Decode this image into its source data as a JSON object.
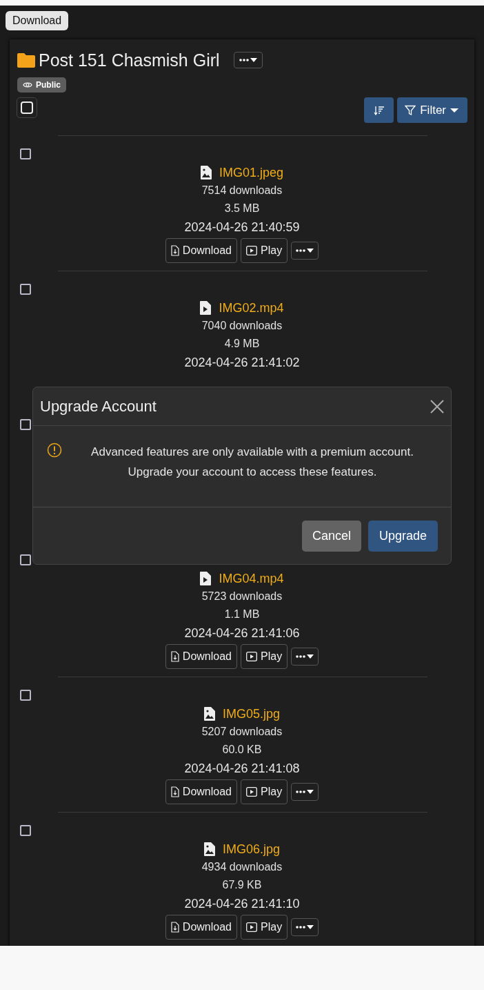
{
  "tooltip": "Download",
  "folder": {
    "title": "Post 151 Chasmish Girl",
    "visibility": "Public",
    "all_checked": false
  },
  "toolbar": {
    "filter": "Filter"
  },
  "rows": [
    {
      "checked": false,
      "kind": "image",
      "name": "IMG01.jpeg",
      "downloads": "7514 downloads",
      "size": "3.5 MB",
      "date": "2024-04-26 21:40:59",
      "actions": [
        "Download",
        "Play"
      ]
    },
    {
      "checked": false,
      "kind": "video",
      "name": "IMG02.mp4",
      "downloads": "7040 downloads",
      "size": "4.9 MB",
      "date": "2024-04-26 21:41:02"
    },
    {
      "checked": false
    },
    {
      "checked": false,
      "kind": "video",
      "name": "IMG04.mp4",
      "downloads": "5723 downloads",
      "size": "1.1 MB",
      "date": "2024-04-26 21:41:06",
      "actions": [
        "Download",
        "Play"
      ]
    },
    {
      "checked": false,
      "kind": "image",
      "name": "IMG05.jpg",
      "downloads": "5207 downloads",
      "size": "60.0 KB",
      "date": "2024-04-26 21:41:08",
      "actions": [
        "Download",
        "Play"
      ]
    },
    {
      "checked": false,
      "kind": "image",
      "name": "IMG06.jpg",
      "downloads": "4934 downloads",
      "size": "67.9 KB",
      "date": "2024-04-26 21:41:10",
      "actions": [
        "Download",
        "Play"
      ]
    }
  ],
  "modal": {
    "title": "Upgrade Account",
    "message": "Advanced features are only available with a premium account. Upgrade your account to access these features.",
    "buttons": [
      "Cancel",
      "Upgrade"
    ]
  }
}
